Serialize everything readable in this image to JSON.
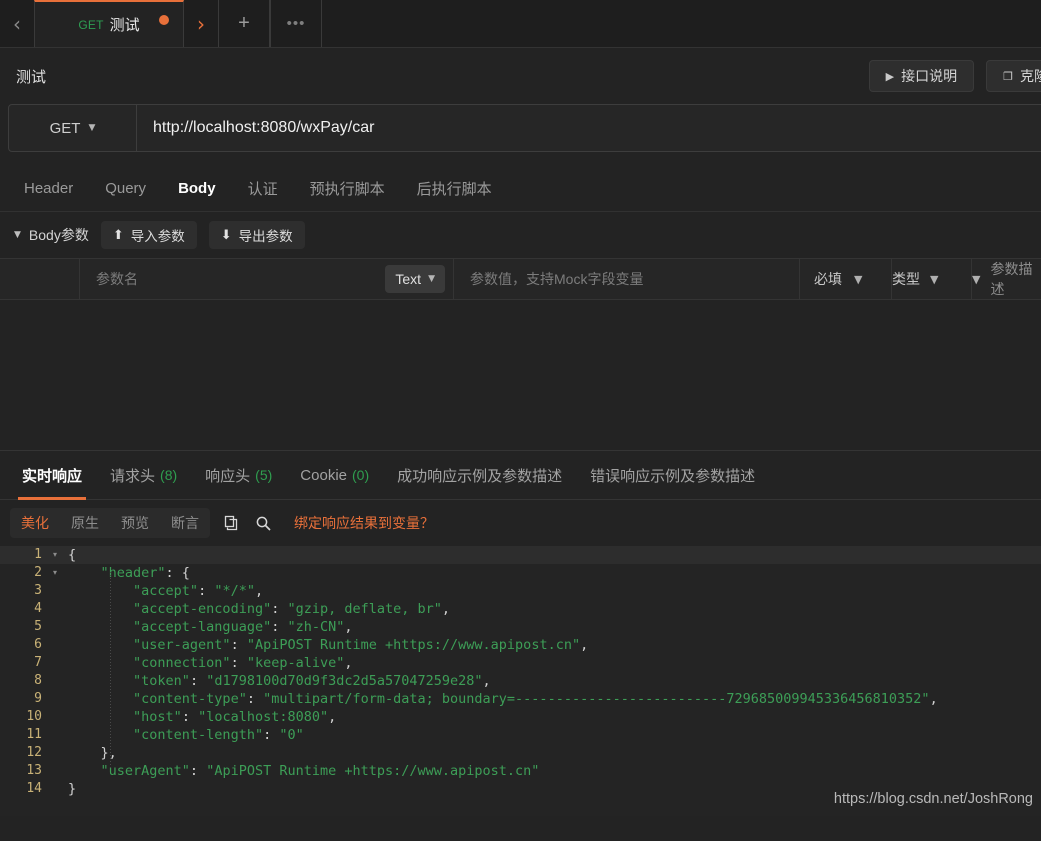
{
  "tabbar": {
    "nav_prev": "‹",
    "nav_next": "›",
    "tab": {
      "method": "GET",
      "name": "测试"
    },
    "add_label": "+",
    "more_label": "•••"
  },
  "header": {
    "title": "测试",
    "doc_button": "接口说明",
    "clone_button": "克隆"
  },
  "url_bar": {
    "method": "GET",
    "url": "http://localhost:8080/wxPay/car"
  },
  "request_tabs": [
    {
      "label": "Header",
      "active": false
    },
    {
      "label": "Query",
      "active": false
    },
    {
      "label": "Body",
      "active": true
    },
    {
      "label": "认证",
      "active": false
    },
    {
      "label": "预执行脚本",
      "active": false
    },
    {
      "label": "后执行脚本",
      "active": false
    }
  ],
  "body_toolbar": {
    "title": "Body参数",
    "import_label": "导入参数",
    "export_label": "导出参数"
  },
  "params_table": {
    "name_placeholder": "参数名",
    "type_chip": "Text",
    "value_placeholder": "参数值，支持Mock字段变量",
    "required_label": "必填",
    "type_label": "类型",
    "desc_label": "参数描述"
  },
  "response_tabs": [
    {
      "label": "实时响应",
      "count": "",
      "active": true
    },
    {
      "label": "请求头",
      "count": "(8)",
      "active": false
    },
    {
      "label": "响应头",
      "count": "(5)",
      "active": false
    },
    {
      "label": "Cookie",
      "count": "(0)",
      "active": false
    },
    {
      "label": "成功响应示例及参数描述",
      "count": "",
      "active": false
    },
    {
      "label": "错误响应示例及参数描述",
      "count": "",
      "active": false
    }
  ],
  "response_toolbar": {
    "views": [
      {
        "label": "美化",
        "active": true
      },
      {
        "label": "原生",
        "active": false
      },
      {
        "label": "预览",
        "active": false
      },
      {
        "label": "断言",
        "active": false
      }
    ],
    "copy_icon": "copy-icon",
    "search_icon": "search-icon",
    "bind_link": "绑定响应结果到变量？"
  },
  "code": {
    "lines": [
      {
        "n": "1",
        "fold": "▾",
        "text": "{",
        "hl": true
      },
      {
        "n": "2",
        "fold": "▾",
        "text": "    \"header\": {",
        "hl": false
      },
      {
        "n": "3",
        "fold": "",
        "text": "        \"accept\": \"*/*\",",
        "hl": false
      },
      {
        "n": "4",
        "fold": "",
        "text": "        \"accept-encoding\": \"gzip, deflate, br\",",
        "hl": false
      },
      {
        "n": "5",
        "fold": "",
        "text": "        \"accept-language\": \"zh-CN\",",
        "hl": false
      },
      {
        "n": "6",
        "fold": "",
        "text": "        \"user-agent\": \"ApiPOST Runtime +https://www.apipost.cn\",",
        "hl": false
      },
      {
        "n": "7",
        "fold": "",
        "text": "        \"connection\": \"keep-alive\",",
        "hl": false
      },
      {
        "n": "8",
        "fold": "",
        "text": "        \"token\": \"d1798100d70d9f3dc2d5a57047259e28\",",
        "hl": false
      },
      {
        "n": "9",
        "fold": "",
        "text": "        \"content-type\": \"multipart/form-data; boundary=--------------------------729685009945336456810352\",",
        "hl": false
      },
      {
        "n": "10",
        "fold": "",
        "text": "        \"host\": \"localhost:8080\",",
        "hl": false
      },
      {
        "n": "11",
        "fold": "",
        "text": "        \"content-length\": \"0\"",
        "hl": false
      },
      {
        "n": "12",
        "fold": "",
        "text": "    },",
        "hl": false
      },
      {
        "n": "13",
        "fold": "",
        "text": "    \"userAgent\": \"ApiPOST Runtime +https://www.apipost.cn\"",
        "hl": false
      },
      {
        "n": "14",
        "fold": "",
        "text": "}",
        "hl": false
      }
    ]
  },
  "watermark": "https://blog.csdn.net/JoshRong",
  "colors": {
    "accent": "#e8703a",
    "string": "#3d9e57",
    "method_get": "#2e9e52",
    "gutter": "#c9b277",
    "bg": "#232323"
  }
}
